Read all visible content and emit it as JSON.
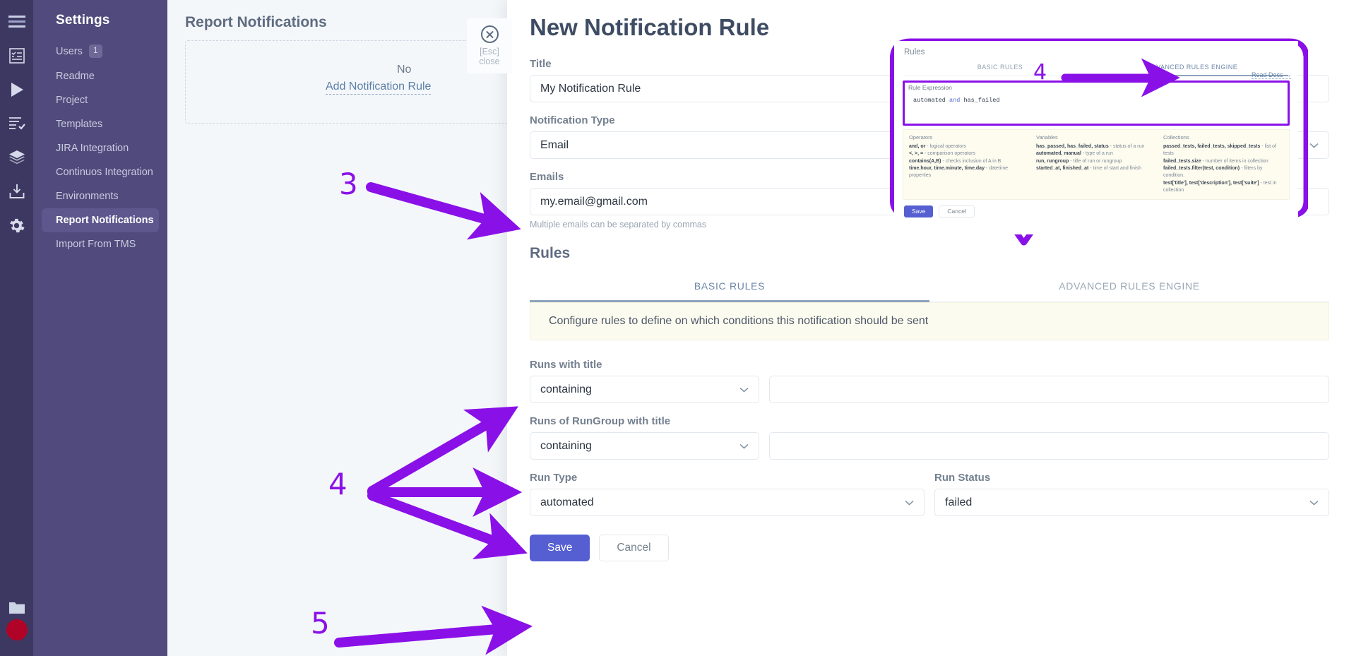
{
  "icon_rail": {
    "icons": [
      "menu-icon",
      "checklist-icon",
      "play-icon",
      "test-results-icon",
      "layers-icon",
      "import-icon",
      "gear-icon",
      "folder-icon",
      "record-dot-icon"
    ]
  },
  "sidebar": {
    "title": "Settings",
    "items": [
      {
        "label": "Users",
        "badge": "1",
        "active": false
      },
      {
        "label": "Readme",
        "badge": "",
        "active": false
      },
      {
        "label": "Project",
        "badge": "",
        "active": false
      },
      {
        "label": "Templates",
        "badge": "",
        "active": false
      },
      {
        "label": "JIRA Integration",
        "badge": "",
        "active": false
      },
      {
        "label": "Continuos Integration",
        "badge": "",
        "active": false
      },
      {
        "label": "Environments",
        "badge": "",
        "active": false
      },
      {
        "label": "Report Notifications",
        "badge": "",
        "active": true
      },
      {
        "label": "Import From TMS",
        "badge": "",
        "active": false
      }
    ]
  },
  "background_page": {
    "heading": "Report Notifications",
    "add_link": "Add Notification Rule",
    "empty_text": "No"
  },
  "esc_close": {
    "icon": "close-circle-icon",
    "line1": "[Esc]",
    "line2": "close"
  },
  "modal": {
    "title": "New Notification Rule",
    "title_field": {
      "label": "Title",
      "value": "My Notification Rule"
    },
    "notification_type": {
      "label": "Notification Type",
      "value": "Email"
    },
    "emails": {
      "label": "Emails",
      "value": "my.email@gmail.com",
      "hint": "Multiple emails can be separated by commas"
    },
    "rules_section_title": "Rules",
    "tabs": [
      {
        "label": "BASIC RULES",
        "active": true
      },
      {
        "label": "ADVANCED RULES ENGINE",
        "active": false
      }
    ],
    "info_banner": "Configure rules to define on which conditions this notification should be sent",
    "runs_with_title": {
      "label": "Runs with title",
      "operator": "containing",
      "value": ""
    },
    "runs_of_rungroup": {
      "label": "Runs of RunGroup with title",
      "operator": "containing",
      "value": ""
    },
    "run_type": {
      "label": "Run Type",
      "value": "automated"
    },
    "run_status": {
      "label": "Run Status",
      "value": "failed"
    },
    "save_label": "Save",
    "cancel_label": "Cancel"
  },
  "callout": {
    "rules_label": "Rules",
    "tabs": [
      {
        "label": "BASIC RULES",
        "active": false
      },
      {
        "label": "ADVANCED RULES ENGINE",
        "active": true
      }
    ],
    "expression_label": "Rule Expression",
    "expression_pre": "automated",
    "expression_kw": "and",
    "expression_post": "has_failed",
    "read_docs": "Read Docs →",
    "help": {
      "operators": {
        "heading": "Operators",
        "items": [
          {
            "term": "and, or",
            "desc": " - logical operators"
          },
          {
            "term": "<, >, =",
            "desc": " - comparison operators"
          },
          {
            "term": "contains(A,B)",
            "desc": " - checks inclusion of A in B"
          },
          {
            "term": "time.hour, time.minute, time.day",
            "desc": " - datetime properties"
          }
        ]
      },
      "variables": {
        "heading": "Variables",
        "items": [
          {
            "term": "has_passed, has_failed, status",
            "desc": " - status of a run"
          },
          {
            "term": "automated, manual",
            "desc": " - type of a run"
          },
          {
            "term": "run, rungroup",
            "desc": " - title of run or rungroup"
          },
          {
            "term": "started_at, finished_at",
            "desc": " - time of start and finish"
          }
        ]
      },
      "collections": {
        "heading": "Collections",
        "items": [
          {
            "term": "passed_tests, failed_tests, skipped_tests",
            "desc": " - list of tests"
          },
          {
            "term": "failed_tests.size",
            "desc": " - number of items in collection"
          },
          {
            "term": "failed_tests.filter(test, condition)",
            "desc": " - filters by condition."
          },
          {
            "term": "test['title'], test['description'], test['suite']",
            "desc": " - test in collection"
          }
        ]
      }
    },
    "save_label": "Save",
    "cancel_label": "Cancel"
  },
  "annotations": {
    "accent_color": "#8a10e8",
    "markers": [
      {
        "id": "3",
        "label": "3"
      },
      {
        "id": "4-callout",
        "label": "4"
      },
      {
        "id": "4-fields",
        "label": "4"
      },
      {
        "id": "5",
        "label": "5"
      }
    ]
  }
}
